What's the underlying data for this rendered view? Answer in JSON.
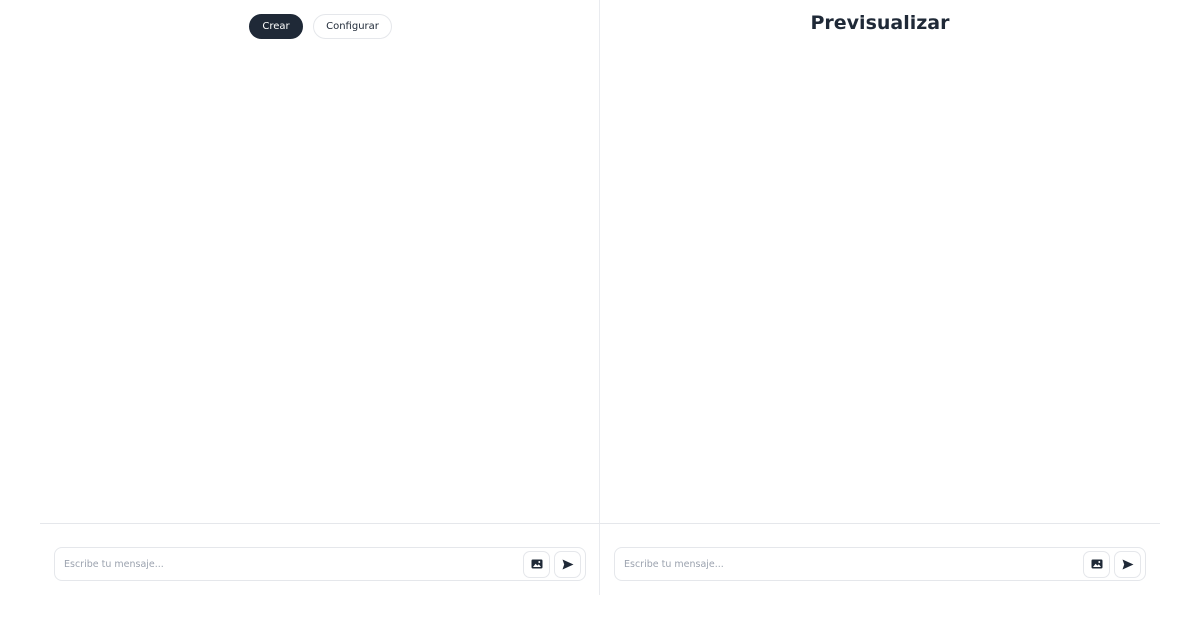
{
  "builder": {
    "tabs": [
      {
        "label": "Crear",
        "active": true
      },
      {
        "label": "Configurar",
        "active": false
      }
    ],
    "composer": {
      "placeholder": "Escribe tu mensaje...",
      "image_icon": "image-icon",
      "send_icon": "send-icon"
    }
  },
  "preview": {
    "title": "Previsualizar",
    "composer": {
      "placeholder": "Escribe tu mensaje...",
      "image_icon": "image-icon",
      "send_icon": "send-icon"
    }
  },
  "colors": {
    "accent": "#1f2937",
    "border": "#e5e7eb",
    "placeholder": "#9ca3af"
  }
}
